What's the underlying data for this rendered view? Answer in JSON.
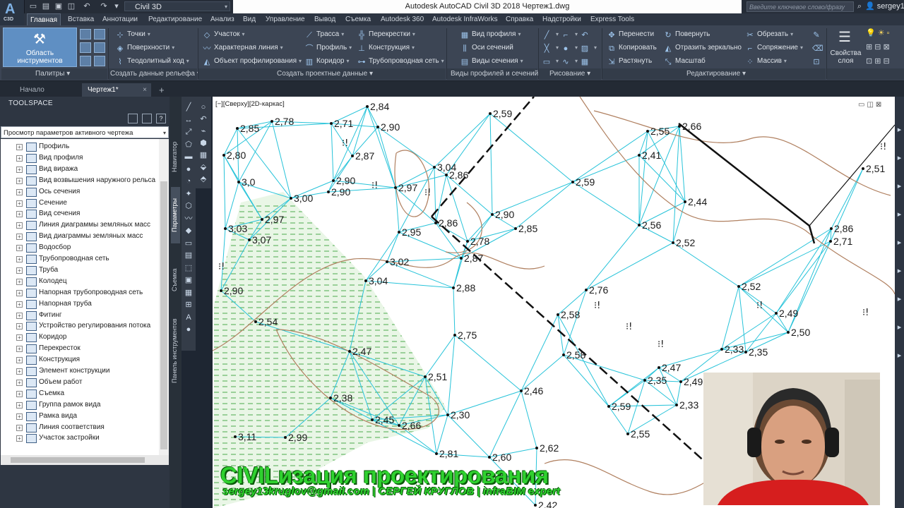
{
  "app": {
    "logo_text": "C3D",
    "workspace": "Civil 3D",
    "title": "Autodesk AutoCAD Civil 3D 2018   Чертеж1.dwg",
    "search_placeholder": "Введите ключевое слово/фразу",
    "user": "sergey1"
  },
  "ribbon_tabs": [
    "Главная",
    "Вставка",
    "Аннотации",
    "Редактирование",
    "Анализ",
    "Вид",
    "Управление",
    "Вывод",
    "Съемка",
    "Autodesk 360",
    "Autodesk InfraWorks",
    "Справка",
    "Надстройки",
    "Express Tools"
  ],
  "active_tab": "Главная",
  "ribbon": {
    "toolspace_button": "Область инструментов",
    "palettes_group": "Палитры",
    "terrain_group": {
      "label": "Создать данные рельефа",
      "items": [
        "Точки",
        "Поверхности",
        "Теодолитный ход"
      ]
    },
    "design_group": {
      "label": "Создать проектные данные",
      "items": [
        "Участок",
        "Характерная линия",
        "Объект профилирования",
        "Трасса",
        "Профиль",
        "Коридор",
        "Перекрестки",
        "Конструкция",
        "Трубопроводная сеть"
      ]
    },
    "profile_group": {
      "label": "Виды профилей и сечений",
      "items": [
        "Вид профиля",
        "Оси сечений",
        "Виды сечения"
      ]
    },
    "draw_group": "Рисование",
    "modify_group": {
      "label": "Редактирование",
      "items": [
        "Перенести",
        "Копировать",
        "Растянуть",
        "Повернуть",
        "Отразить зеркально",
        "Масштаб",
        "Обрезать",
        "Сопряжение",
        "Массив"
      ]
    },
    "layer_props": "Свойства слоя"
  },
  "doc_tabs": [
    {
      "label": "Начало"
    },
    {
      "label": "Чертеж1*"
    }
  ],
  "toolspace": {
    "title": "TOOLSPACE",
    "dropdown": "Просмотр параметров активного чертежа",
    "items": [
      "Профиль",
      "Вид профиля",
      "Вид виража",
      "Вид возвышения наружного рельса",
      "Ось сечения",
      "Сечение",
      "Вид сечения",
      "Линия диаграммы земляных масс",
      "Вид диаграммы земляных масс",
      "Водосбор",
      "Трубопроводная сеть",
      "Труба",
      "Колодец",
      "Напорная трубопроводная сеть",
      "Напорная труба",
      "Фитинг",
      "Устройство регулирования потока",
      "Коридор",
      "Перекресток",
      "Конструкция",
      "Элемент конструкции",
      "Объем работ",
      "Съемка",
      "Группа рамок вида",
      "Рамка вида",
      "Линия соответствия",
      "Участок застройки"
    ],
    "side_tabs": [
      "Навигатор",
      "Параметры",
      "Съемка",
      "Панель инструментов"
    ]
  },
  "viewport": {
    "label": "[−][Сверху][2D-каркас]",
    "points": [
      {
        "v": "2,84"
      },
      {
        "v": "2,85"
      },
      {
        "v": "2,78"
      },
      {
        "v": "2,71"
      },
      {
        "v": "2,90"
      },
      {
        "v": "2,59"
      },
      {
        "v": "2,55"
      },
      {
        "v": "2,66"
      },
      {
        "v": "2,80"
      },
      {
        "v": "2,87"
      },
      {
        "v": "2,41"
      },
      {
        "v": "2,51"
      },
      {
        "v": "3,0"
      },
      {
        "v": "3,04"
      },
      {
        "v": "2,86"
      },
      {
        "v": "2,90"
      },
      {
        "v": "2,90"
      },
      {
        "v": "2,97"
      },
      {
        "v": "2,59"
      },
      {
        "v": "3,00"
      },
      {
        "v": "2,44"
      },
      {
        "v": "2,97"
      },
      {
        "v": "2,86"
      },
      {
        "v": "2,90"
      },
      {
        "v": "3,03"
      },
      {
        "v": "2,95"
      },
      {
        "v": "2,78"
      },
      {
        "v": "2,85"
      },
      {
        "v": "2,56"
      },
      {
        "v": "2,86"
      },
      {
        "v": "2,71"
      },
      {
        "v": "3,07"
      },
      {
        "v": "2,52"
      },
      {
        "v": "3,02"
      },
      {
        "v": "2,87"
      },
      {
        "v": "3,04"
      },
      {
        "v": "2,88"
      },
      {
        "v": "2,76"
      },
      {
        "v": "2,52"
      },
      {
        "v": "2,90"
      },
      {
        "v": "2,58"
      },
      {
        "v": "2,49"
      },
      {
        "v": "2,54"
      },
      {
        "v": "2,75"
      },
      {
        "v": "2,50"
      },
      {
        "v": "2,47"
      },
      {
        "v": "2,58"
      },
      {
        "v": "2,33"
      },
      {
        "v": "2,35"
      },
      {
        "v": "2,47"
      },
      {
        "v": "2,51"
      },
      {
        "v": "2,35"
      },
      {
        "v": "2,49"
      },
      {
        "v": "2,46"
      },
      {
        "v": "2,38"
      },
      {
        "v": "2,59"
      },
      {
        "v": "2,33"
      },
      {
        "v": "2,30"
      },
      {
        "v": "2,45"
      },
      {
        "v": "2,66"
      },
      {
        "v": "2,55"
      },
      {
        "v": "3,11"
      },
      {
        "v": "2,99"
      },
      {
        "v": "2,81"
      },
      {
        "v": "2,60"
      },
      {
        "v": "2,62"
      },
      {
        "v": "2,42"
      }
    ]
  },
  "watermark": {
    "line1": "CIVILизация проектирования",
    "line2": "sergey13kruglov@gmail.com | СЕРГЕЙ КРУГЛОВ | infraBIM expert"
  }
}
